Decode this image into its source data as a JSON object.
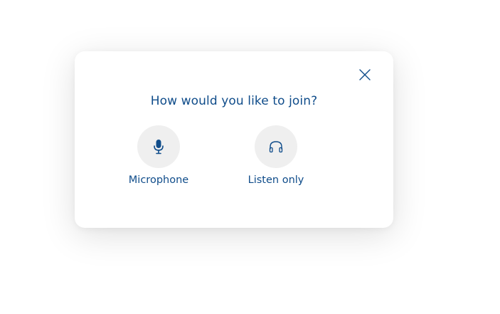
{
  "dialog": {
    "title": "How would you like to join?",
    "options": [
      {
        "label": "Microphone",
        "icon": "microphone-icon"
      },
      {
        "label": "Listen only",
        "icon": "headphones-icon"
      }
    ],
    "close_icon": "close-icon"
  },
  "colors": {
    "accent": "#0f4c8a",
    "icon_circle_bg": "#efefef",
    "backdrop": "#ffffff"
  }
}
